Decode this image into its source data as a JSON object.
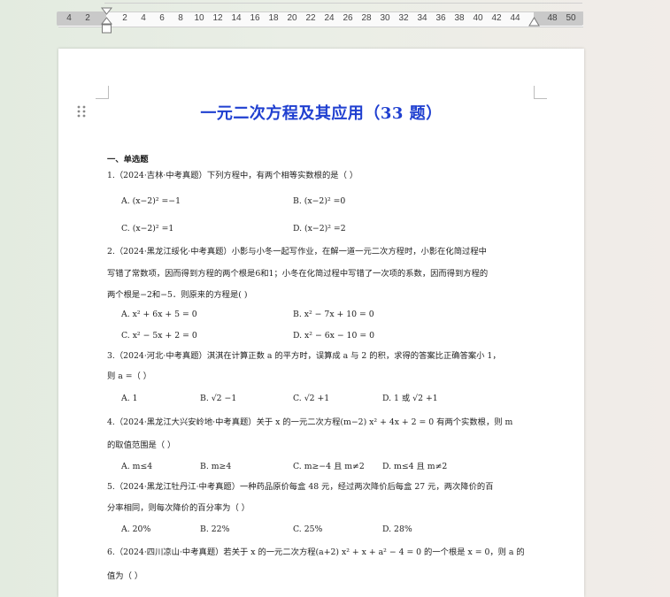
{
  "ruler": {
    "numbers": [
      "4",
      "2",
      "2",
      "4",
      "6",
      "8",
      "10",
      "12",
      "14",
      "16",
      "18",
      "20",
      "22",
      "24",
      "26",
      "28",
      "30",
      "32",
      "34",
      "36",
      "38",
      "40",
      "42",
      "44",
      "48",
      "50"
    ]
  },
  "document": {
    "title": "一元二次方程及其应用（33 题）",
    "section": "一、单选题",
    "q1": {
      "stem": "1.（2024·吉林·中考真题）下列方程中，有两个相等实数根的是（    ）",
      "A": "A.  (x−2)² =−1",
      "B": "B.  (x−2)² =0",
      "C": "C.  (x−2)² =1",
      "D": "D.  (x−2)² =2"
    },
    "q2": {
      "line1": "2.（2024·黑龙江绥化·中考真题）小影与小冬一起写作业，在解一道一元二次方程时，小影在化简过程中",
      "line2": "写错了常数项，因而得到方程的两个根是6和1；小冬在化简过程中写错了一次项的系数，因而得到方程的",
      "line3": "两个根是−2和−5．则原来的方程是(    )",
      "A": "A.  x² + 6x + 5 = 0",
      "B": "B.  x² − 7x + 10 = 0",
      "C": "C.  x² − 5x + 2 = 0",
      "D": "D.  x² − 6x − 10 = 0"
    },
    "q3": {
      "line1": "3.（2024·河北·中考真题）淇淇在计算正数 a 的平方时，误算成 a 与 2 的积，求得的答案比正确答案小 1，",
      "line2": "则 a =（    ）",
      "A": "A.  1",
      "B": "B.  √2 −1",
      "C": "C.  √2 +1",
      "D": "D.  1 或 √2 +1"
    },
    "q4": {
      "line1": "4.（2024·黑龙江大兴安岭地·中考真题）关于 x 的一元二次方程(m−2) x² + 4x + 2 = 0 有两个实数根，则 m",
      "line2": "的取值范围是（    ）",
      "A": "A.   m≤4",
      "B": "B.   m≥4",
      "C": "C.   m≥−4 且 m≠2",
      "D": "D.   m≤4 且 m≠2"
    },
    "q5": {
      "line1": "5.（2024·黑龙江牡丹江·中考真题）一种药品原价每盒 48 元，经过两次降价后每盒 27 元，两次降价的百",
      "line2": "分率相同，则每次降价的百分率为（    ）",
      "A": "A.   20%",
      "B": "B.   22%",
      "C": "C.   25%",
      "D": "D.   28%"
    },
    "q6": {
      "line1": "6.（2024·四川凉山·中考真题）若关于 x 的一元二次方程(a+2) x² + x + a² − 4 = 0 的一个根是 x = 0，则 a 的",
      "line2": "值为（    ）"
    }
  },
  "colors": {
    "title": "#1f3fd0",
    "ruler_margin": "#c9c9c9",
    "page": "#ffffff"
  }
}
